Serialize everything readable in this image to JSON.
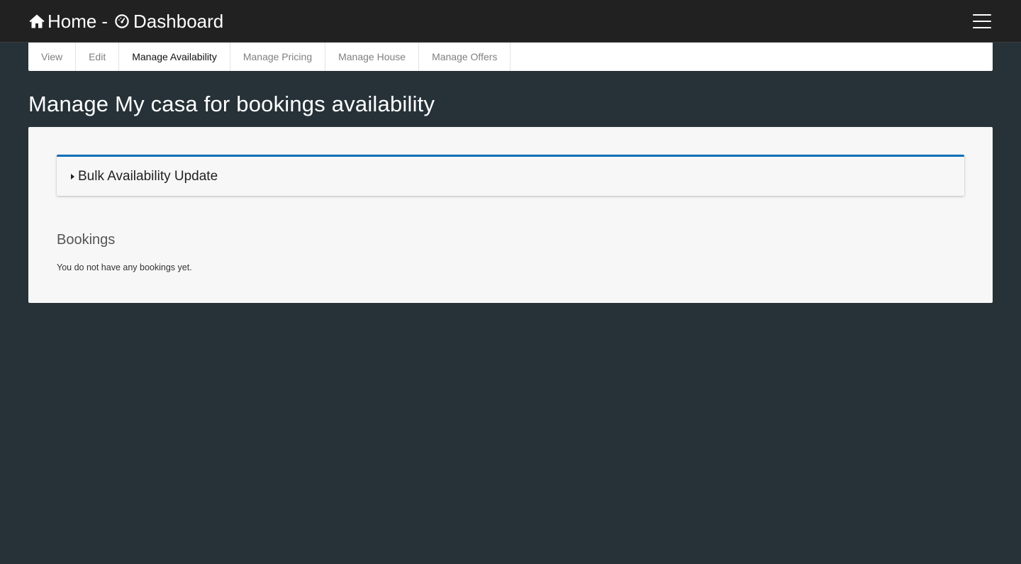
{
  "navbar": {
    "home_label": "Home",
    "separator": "-",
    "dashboard_label": "Dashboard",
    "home_icon": "home-icon",
    "dashboard_icon": "dashboard-gauge-icon",
    "menu_icon": "hamburger-menu-icon",
    "background_color": "#212121"
  },
  "tabs": [
    {
      "label": "View",
      "active": false
    },
    {
      "label": "Edit",
      "active": false
    },
    {
      "label": "Manage Availability",
      "active": true
    },
    {
      "label": "Manage Pricing",
      "active": false
    },
    {
      "label": "Manage House",
      "active": false
    },
    {
      "label": "Manage Offers",
      "active": false
    }
  ],
  "page": {
    "title": "Manage My casa for bookings availability",
    "background_color": "#263238"
  },
  "accordion": {
    "label": "Bulk Availability Update",
    "expanded": false,
    "accent_color": "#0d6fb8"
  },
  "bookings": {
    "heading": "Bookings",
    "empty_message": "You do not have any bookings yet."
  }
}
